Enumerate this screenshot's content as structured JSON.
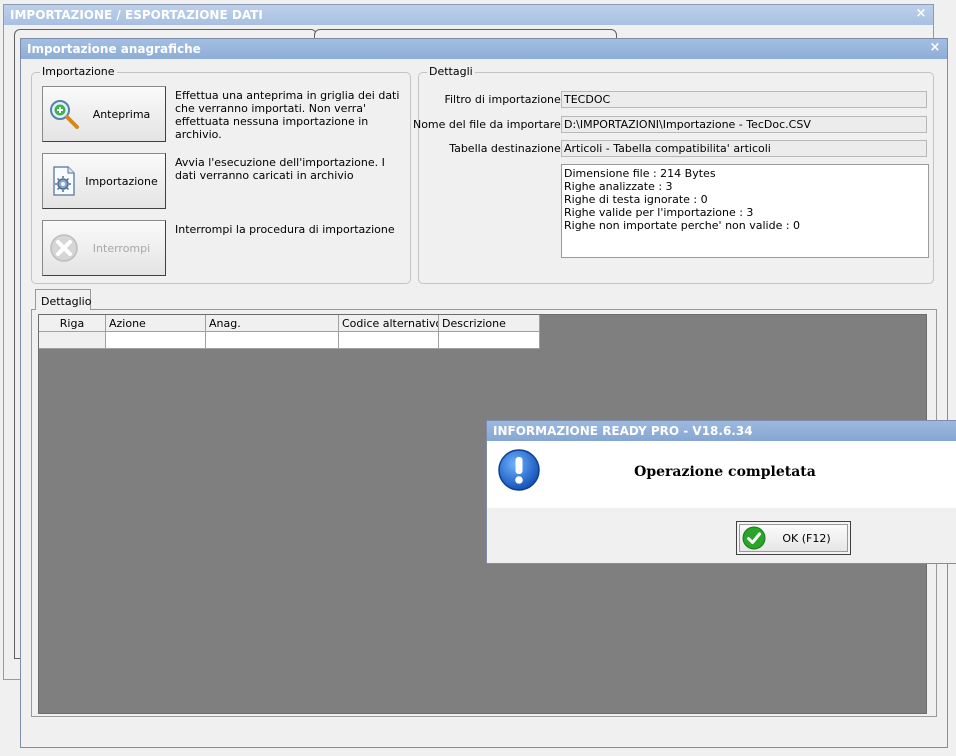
{
  "background_window": {
    "title": "IMPORTAZIONE / ESPORTAZIONE DATI",
    "close_glyph": "×"
  },
  "main_window": {
    "title": "Importazione anagrafiche",
    "close_glyph": "×",
    "import_group": {
      "label": "Importazione",
      "buttons": [
        {
          "label": "Anteprima",
          "icon": "magnifier-plus-icon",
          "enabled": true,
          "description": "Effettua una anteprima in griglia dei dati che verranno importati. Non verra' effettuata nessuna importazione in archivio."
        },
        {
          "label": "Importazione",
          "icon": "document-gear-icon",
          "enabled": true,
          "description": "Avvia l'esecuzione dell'importazione. I dati verranno caricati in archivio"
        },
        {
          "label": "Interrompi",
          "icon": "stop-x-icon",
          "enabled": false,
          "description": "Interrompi la procedura di importazione"
        }
      ]
    },
    "details_group": {
      "label": "Dettagli",
      "fields": [
        {
          "label": "Filtro di importazione :",
          "value": "TECDOC"
        },
        {
          "label": "Nome del file da importare :",
          "value": "D:\\IMPORTAZIONI\\Importazione - TecDoc.CSV"
        },
        {
          "label": "Tabella destinazione :",
          "value": "Articoli - Tabella compatibilita' articoli"
        }
      ],
      "summary_lines": [
        "Dimensione file : 214 Bytes",
        "Righe analizzate : 3",
        "Righe di testa ignorate : 0",
        "Righe valide per l'importazione : 3",
        "Righe non importate perche' non valide : 0"
      ]
    },
    "detail_tab": {
      "label": "Dettaglio",
      "grid": {
        "columns": [
          "Riga",
          "Azione",
          "Anag.",
          "Codice alternativo",
          "Descrizione"
        ],
        "rows": [
          [
            "",
            "",
            "",
            "",
            ""
          ]
        ]
      }
    }
  },
  "info_dialog": {
    "title": "INFORMAZIONE READY PRO - V18.6.34",
    "message": "Operazione completata",
    "icon": "exclamation-info-icon",
    "ok_label": "OK (F12)",
    "ok_icon": "checkmark-icon"
  },
  "colors": {
    "titlebar": "#8eadd6",
    "grid_background": "#807f80",
    "info_icon_blue": "#1a5fc8",
    "ok_green": "#2aa52a"
  }
}
